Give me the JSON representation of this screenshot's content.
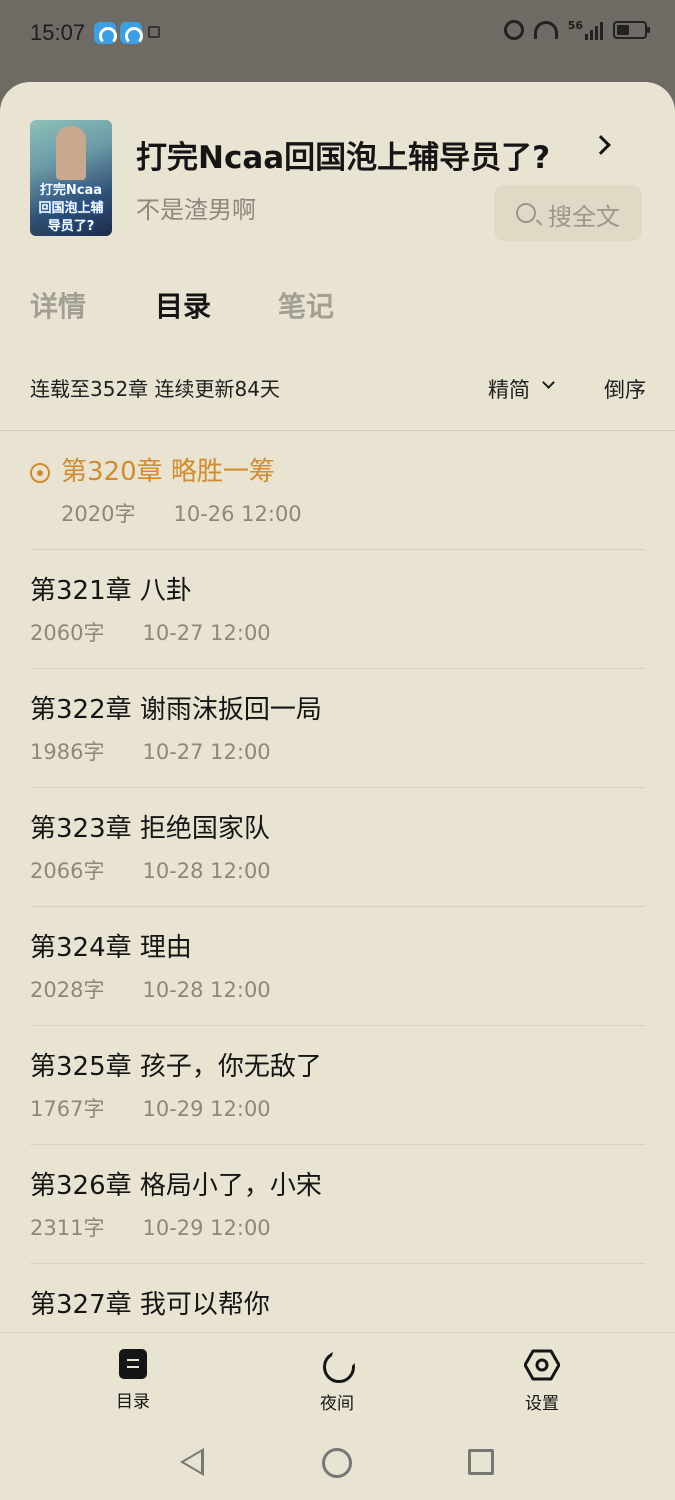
{
  "status_bar": {
    "time": "15:07",
    "network": "56"
  },
  "book": {
    "title": "打完Ncaa回国泡上辅导员了?",
    "author": "不是渣男啊",
    "cover_text": "打完Ncaa回国泡上辅导员了?",
    "search_label": "搜全文"
  },
  "tabs": [
    {
      "label": "详情"
    },
    {
      "label": "目录"
    },
    {
      "label": "笔记"
    }
  ],
  "toc_header": {
    "update_info": "连载至352章 连续更新84天",
    "lang_option": "精简",
    "order_label": "倒序"
  },
  "chapters": [
    {
      "title": "第320章 略胜一筹",
      "words": "2020字",
      "date": "10-26 12:00"
    },
    {
      "title": "第321章 八卦",
      "words": "2060字",
      "date": "10-27 12:00"
    },
    {
      "title": "第322章 谢雨沫扳回一局",
      "words": "1986字",
      "date": "10-27 12:00"
    },
    {
      "title": "第323章 拒绝国家队",
      "words": "2066字",
      "date": "10-28 12:00"
    },
    {
      "title": "第324章 理由",
      "words": "2028字",
      "date": "10-28 12:00"
    },
    {
      "title": "第325章 孩子，你无敌了",
      "words": "1767字",
      "date": "10-29 12:00"
    },
    {
      "title": "第326章 格局小了，小宋",
      "words": "2311字",
      "date": "10-29 12:00"
    },
    {
      "title": "第327章 我可以帮你",
      "words": "",
      "date": ""
    }
  ],
  "bottom_bar": {
    "toc_label": "目录",
    "night_label": "夜间",
    "settings_label": "设置"
  },
  "colors": {
    "sheet_bg": "#e9e4d2",
    "current_chapter": "#d18c2e",
    "muted_text": "#8c887c"
  }
}
